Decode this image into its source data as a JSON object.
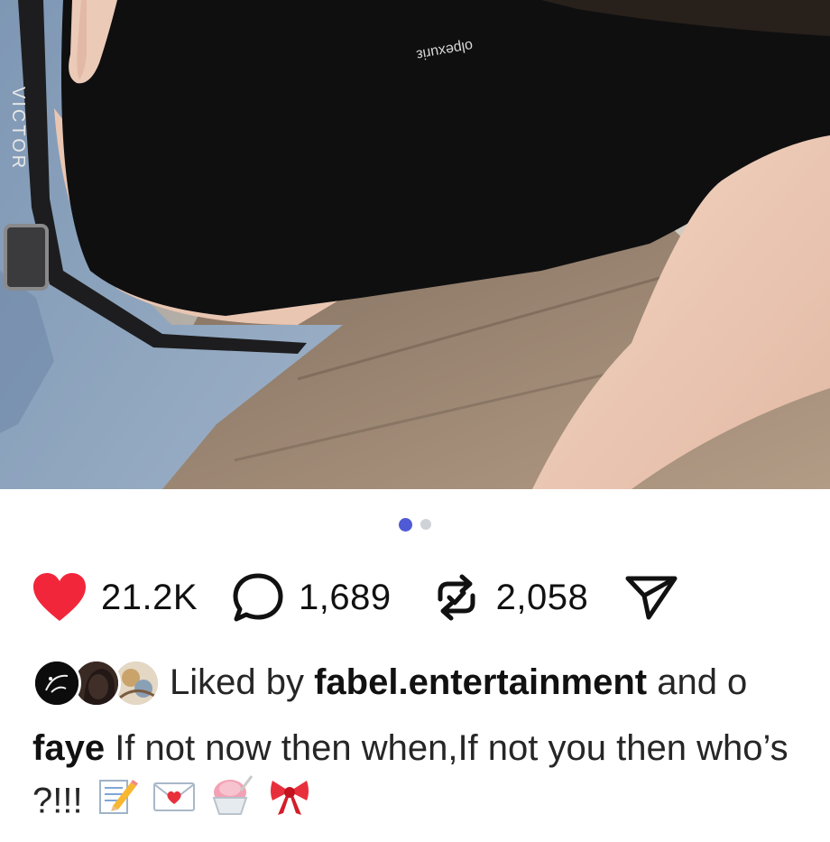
{
  "post": {
    "carousel": {
      "total_slides": 2,
      "active_slide": 1
    },
    "photo": {
      "waistband_text": "VICTOR",
      "shirt_print_text": "olpexuriε"
    },
    "actions": {
      "likes_count": "21.2K",
      "comments_count": "1,689",
      "reposts_count": "2,058"
    },
    "liked_by": {
      "prefix": "Liked by",
      "username": "fabel.entertainment",
      "suffix": "and o"
    },
    "caption": {
      "username": "faye",
      "text": "If not now then when,If not you then who’s ?!!!"
    },
    "icons": {
      "like": "heart-icon",
      "comment": "comment-bubble-icon",
      "repost": "repost-icon",
      "share": "send-icon",
      "caption_emojis": [
        "memo-emoji",
        "love-letter-emoji",
        "shaved-ice-emoji",
        "ribbon-emoji"
      ]
    },
    "colors": {
      "like": "#f2263a",
      "carousel_active": "#4f5bd5",
      "carousel_inactive": "#cfd3d8"
    }
  }
}
